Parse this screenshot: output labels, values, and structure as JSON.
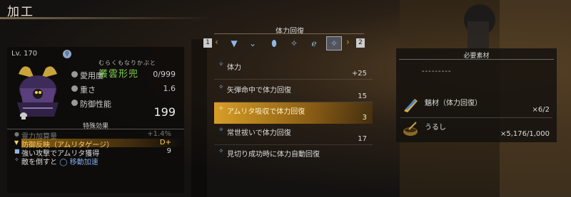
{
  "window": {
    "title": "加工"
  },
  "item": {
    "level_label": "Lv. 170",
    "name_ruby": "むらくもなりかぶと",
    "name": "叢雲形兜",
    "stats": [
      {
        "label": "愛用度",
        "value": "0/999"
      },
      {
        "label": "重さ",
        "value": "1.6"
      },
      {
        "label": "防御性能",
        "value": "199"
      }
    ]
  },
  "effects": {
    "header": "特殊効果",
    "list": [
      {
        "label": "霊力加算量",
        "value": "+1.4%",
        "state": "dim"
      },
      {
        "label": "防御反映（アムリタゲージ）",
        "value": "D+",
        "state": "highlight"
      },
      {
        "label": "強い攻撃でアムリタ獲得",
        "value": "9",
        "state": "normal"
      },
      {
        "label_prefix": "敵を倒すと",
        "label_suffix": "移動加速",
        "value": "",
        "state": "normal"
      }
    ]
  },
  "tabs": {
    "title": "体力回復",
    "left_button": "1",
    "right_button": "2",
    "items": [
      {
        "icon": "triangle-down-icon",
        "glyph": "▼"
      },
      {
        "icon": "chevron-down-icon",
        "glyph": "⌄"
      },
      {
        "icon": "drop-icon",
        "glyph": "⬮"
      },
      {
        "icon": "sparkle-icon",
        "glyph": "✧"
      },
      {
        "icon": "curl-icon",
        "glyph": "ℯ"
      },
      {
        "icon": "sparkle-icon",
        "glyph": "✧"
      }
    ],
    "active_index": 5
  },
  "effect_list": [
    {
      "label": "体力",
      "value": "+25"
    },
    {
      "label": "矢弾命中で体力回復",
      "value": "15"
    },
    {
      "label": "アムリタ吸収で体力回復",
      "value": "3"
    },
    {
      "label": "常世祓いで体力回復",
      "value": "17"
    },
    {
      "label": "見切り成功時に体力自動回復",
      "value": ""
    }
  ],
  "selected_effect_index": 2,
  "materials": {
    "title": "必要素材",
    "placeholder": "---------",
    "items": [
      {
        "name": "魑材（体力回復）",
        "quantity": "×6/2",
        "icon": "talisman-icon"
      },
      {
        "name": "うるし",
        "quantity": "×5,176/1,000",
        "icon": "bowl-icon"
      }
    ]
  }
}
